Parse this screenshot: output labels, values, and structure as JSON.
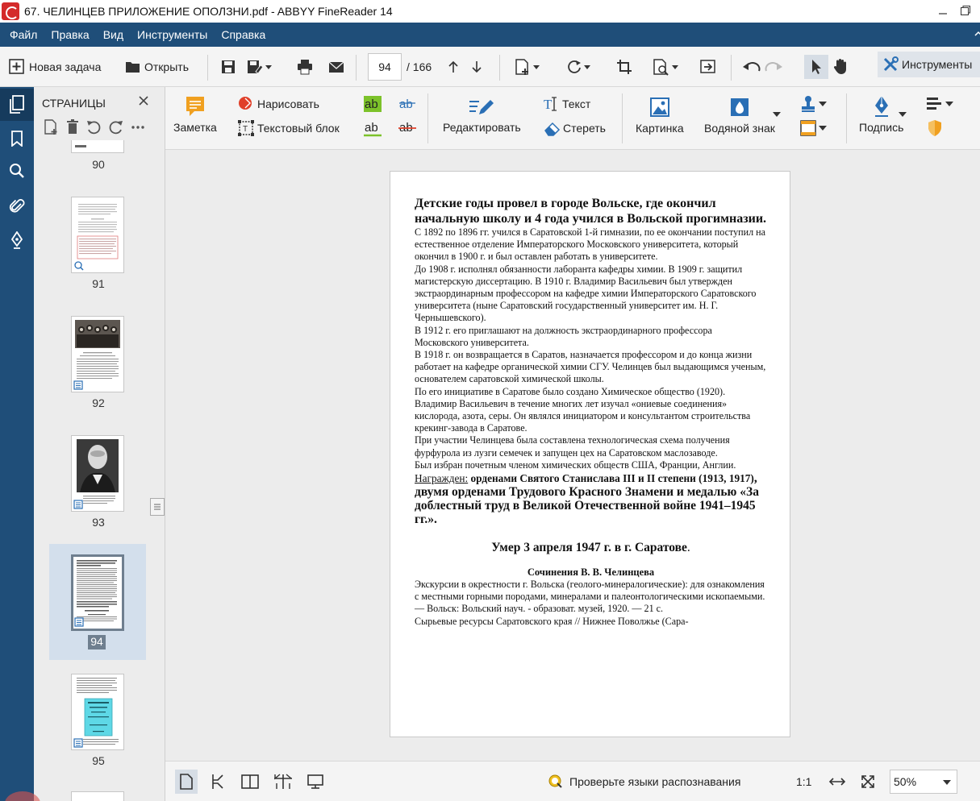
{
  "window": {
    "title": "67.  ЧЕЛИНЦЕВ ПРИЛОЖЕНИЕ  ОПОЛЗНИ.pdf - ABBYY FineReader 14"
  },
  "menu": [
    "Файл",
    "Правка",
    "Вид",
    "Инструменты",
    "Справка"
  ],
  "toolbar": {
    "new_task": "Новая задача",
    "open": "Открыть",
    "page_current": "94",
    "page_total": "/ 166",
    "tools": "Инструменты"
  },
  "pages_panel": {
    "title": "СТРАНИЦЫ",
    "thumbnails": [
      {
        "label": "90"
      },
      {
        "label": "91"
      },
      {
        "label": "92"
      },
      {
        "label": "93"
      },
      {
        "label": "94",
        "selected": true
      },
      {
        "label": "95"
      }
    ]
  },
  "ribbon": {
    "note": "Заметка",
    "draw": "Нарисовать",
    "text_block": "Текстовый блок",
    "edit": "Редактировать",
    "text": "Текст",
    "erase": "Стереть",
    "picture": "Картинка",
    "watermark": "Водяной знак",
    "signature": "Подпись"
  },
  "document": {
    "heading": "Детские годы провел в городе  Вольске, где окончил начальную школу и 4 года учился в Вольской прогимназии.",
    "paragraphs": [
      "С 1892 по 1896 гг. учился в Саратовской 1-й гимназии, по ее окончании поступил на естественное отделение Императорского Московского университета, который окончил в 1900 г. и был оставлен работать в университете.",
      "До 1908 г. исполнял обязанности лаборанта кафедры химии. В 1909 г. защитил магистерскую диссертацию. В 1910 г. Владимир Васильевич был утвержден экстраординарным профессором на кафедре химии Императорского Саратовского университета (ныне Саратовский государственный университет им. Н. Г. Чернышевского).",
      "В 1912 г. его приглашают на должность экстраординарного профессора Московского университета.",
      "В 1918 г. он возвращается в Саратов, назначается профессором и до конца жизни работает на кафедре органической химии СГУ. Челинцев был выдающимся ученым, основателем саратовской химической школы.",
      "По его инициативе в Саратове было создано Химическое общество (1920). Владимир Васильевич в течение многих лет изучал «ониевые соединения» кислорода, азота, серы. Он являлся инициатором и консультантом строительства крекинг-завода в Саратове.",
      "При участии Челинцева была составлена технологическая схема получения фурфурола из лузги семечек и запущен цех на Саратовском маслозаводе.",
      "Был избран почетным членом химических обществ США, Франции, Англии."
    ],
    "award_label": "Награжден:",
    "award_part1": " орденами Святого Станислава III и II степени (1913, 1917)",
    "award_part2": ", двумя орденами Трудового Красного Знамени и медалью «За доблестный труд в Великой Отечественной войне 1941–1945 гг.».",
    "death": "Умер 3 апреля 1947 г. в г. Саратове",
    "death_dot": ".",
    "works_title": "Сочинения В. В. Челинцева",
    "works": [
      "Экскурсии в окрестности г. Вольска (геолого-минералогические): для ознакомления с местными горными породами, минералами и палеонтологическими ископаемыми. — Вольск: Вольский науч. - образоват. музей, 1920. — 21 с.",
      "Сырьевые ресурсы Саратовского края // Нижнее Поволжье (Сара-"
    ]
  },
  "statusbar": {
    "check_languages": "Проверьте языки распознавания",
    "ratio": "1:1",
    "zoom": "50%"
  },
  "colors": {
    "menu_bg": "#1f4e79",
    "rail_bg": "#1f4e79",
    "note_icon": "#f0a020",
    "draw_icon": "#e0402a",
    "highlight_green": "#7cc22a",
    "accent_blue": "#2a6fb5"
  }
}
